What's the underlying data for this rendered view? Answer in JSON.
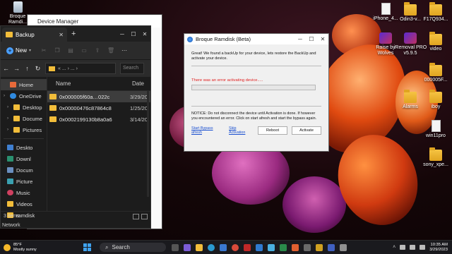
{
  "desktop": {
    "left_icons": [
      {
        "label": "Broque Ramdi...",
        "icon": "recycle-bin-icon"
      }
    ],
    "right_icons": [
      {
        "label": "iPhone_4...",
        "icon": "file-icon"
      },
      {
        "label": "Odin3-v...",
        "icon": "folder-icon"
      },
      {
        "label": "F17Q934...",
        "icon": "folder-icon"
      },
      {
        "label": "Raise by Wolves",
        "icon": "app-icon"
      },
      {
        "label": "iRemoval PRO v5.9.5",
        "icon": "app-icon"
      },
      {
        "label": "video",
        "icon": "folder-icon"
      },
      {
        "label": "000005F...",
        "icon": "folder-icon"
      },
      {
        "label": "Alarms",
        "icon": "folder-icon"
      },
      {
        "label": "iboy",
        "icon": "folder-icon"
      },
      {
        "label": "win11pro",
        "icon": "file-icon"
      },
      {
        "label": "sony_xpe...",
        "icon": "folder-icon"
      }
    ]
  },
  "device_manager": {
    "title": "Device Manager"
  },
  "explorer": {
    "tab_label": "Backup",
    "new_label": "New",
    "address_text": "« ... › ... ›",
    "search_placeholder": "Search",
    "nav_items": [
      {
        "label": "Home",
        "icon": "home-icon",
        "chev": ""
      },
      {
        "label": "OneDrive",
        "icon": "cloud-icon",
        "chev": "›"
      },
      {
        "label": "Desktop",
        "icon": "folder-icon",
        "chev": "›"
      },
      {
        "label": "Docume",
        "icon": "folder-icon",
        "chev": "›"
      },
      {
        "label": "Pictures",
        "icon": "folder-icon",
        "chev": "›"
      },
      {
        "label": "Deskto",
        "icon": "desktop-icon",
        "chev": ""
      },
      {
        "label": "Downl",
        "icon": "download-icon",
        "chev": ""
      },
      {
        "label": "Docum",
        "icon": "document-icon",
        "chev": ""
      },
      {
        "label": "Picture",
        "icon": "pictures-icon",
        "chev": ""
      },
      {
        "label": "Music",
        "icon": "music-icon",
        "chev": ""
      },
      {
        "label": "Videos",
        "icon": "folder-icon",
        "chev": ""
      },
      {
        "label": "ramdisk",
        "icon": "folder-icon",
        "chev": ""
      }
    ],
    "columns": {
      "name": "Name",
      "date": "Date"
    },
    "files": [
      {
        "name": "0x000005f60a…022c",
        "date": "3/29/20"
      },
      {
        "name": "0x00000476c87864c8",
        "date": "1/25/20"
      },
      {
        "name": "0x0002199130b8a0a6",
        "date": "3/14/20"
      }
    ],
    "status": "3 items",
    "network_label": "Network"
  },
  "broque": {
    "title": "Broque Ramdisk (Beta)",
    "intro": "Great! We found a backUp for your device, lets restore the BackUp and activate your device.",
    "error": "There was an error activating device.....",
    "progress": 0,
    "notice": "NOTICE: Do not disconnect the device until Activation is done. If however you encountered an error. Click on start afresh and start the bypass again.",
    "link_start": "Start Bypass afresh",
    "link_skip": "Skip Activation",
    "reboot_label": "Reboot",
    "activate_label": "Activate"
  },
  "taskbar": {
    "temp": "85°F",
    "weather": "Mostly sunny",
    "search_label": "Search",
    "time": "10:35 AM",
    "date": "3/29/2023"
  }
}
